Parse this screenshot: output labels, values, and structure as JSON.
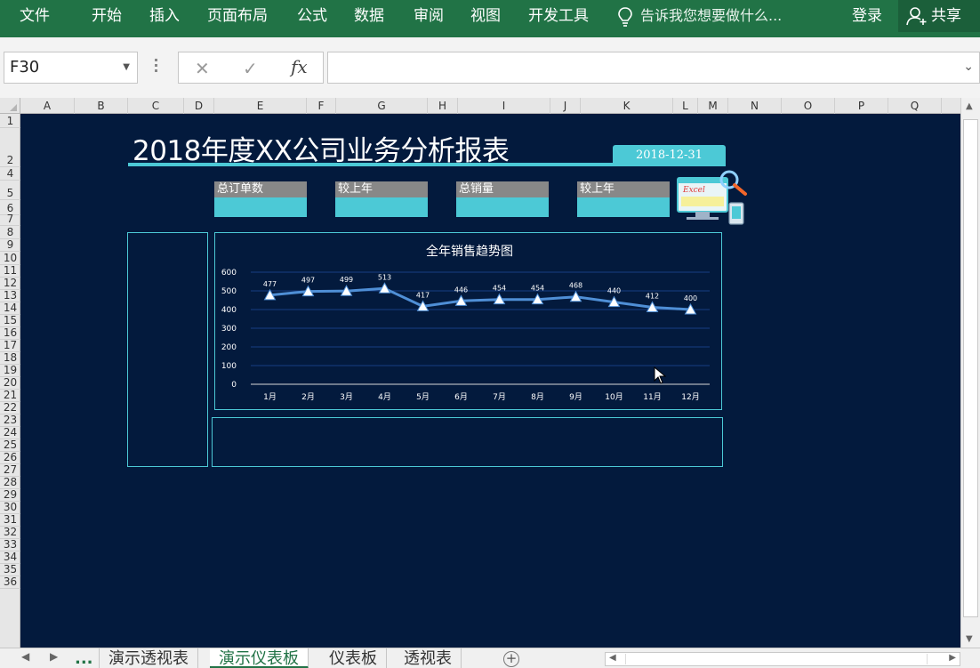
{
  "ribbon": {
    "tabs": [
      "文件",
      "开始",
      "插入",
      "页面布局",
      "公式",
      "数据",
      "审阅",
      "视图",
      "开发工具"
    ],
    "search_text": "告诉我您想要做什么...",
    "login": "登录",
    "share": "共享"
  },
  "formula_bar": {
    "name_box": "F30",
    "fx_label": "fx",
    "formula": ""
  },
  "columns": [
    "A",
    "B",
    "C",
    "D",
    "E",
    "F",
    "G",
    "H",
    "I",
    "J",
    "K",
    "L",
    "M",
    "N",
    "O",
    "P",
    "Q"
  ],
  "rows": [
    "1",
    "2",
    "4",
    "5",
    "6",
    "7",
    "8",
    "9",
    "10",
    "11",
    "12",
    "13",
    "14",
    "15",
    "16",
    "17",
    "18",
    "19",
    "20",
    "21",
    "22",
    "23",
    "24",
    "25",
    "26",
    "27",
    "28",
    "29",
    "30",
    "31",
    "32",
    "33",
    "34",
    "35",
    "36"
  ],
  "report": {
    "title": "2018年度XX公司业务分析报表",
    "date": "2018-12-31",
    "kpis": [
      {
        "label": "总订单数",
        "value": ""
      },
      {
        "label": "较上年",
        "value": ""
      },
      {
        "label": "总销量",
        "value": ""
      },
      {
        "label": "较上年",
        "value": ""
      }
    ],
    "logo_text": "Excel"
  },
  "chart_data": {
    "type": "line",
    "title": "全年销售趋势图",
    "categories": [
      "1月",
      "2月",
      "3月",
      "4月",
      "5月",
      "6月",
      "7月",
      "8月",
      "9月",
      "10月",
      "11月",
      "12月"
    ],
    "values": [
      477,
      497,
      499,
      513,
      417,
      446,
      454,
      454,
      468,
      440,
      412,
      400
    ],
    "ylim": [
      0,
      600
    ],
    "yticks": [
      "0",
      "100",
      "200",
      "300",
      "400",
      "500",
      "600"
    ],
    "grid": true,
    "line_color": "#4f8fd6",
    "grid_color": "#1f4a9a"
  },
  "sheet_tabs": {
    "nav_more": "...",
    "tabs": [
      "演示透视表",
      "演示仪表板",
      "仪表板",
      "透视表"
    ],
    "active_index": 1
  },
  "colors": {
    "ribbon": "#217346",
    "sheet_bg": "#031a3d",
    "accent": "#4cc9d6"
  }
}
